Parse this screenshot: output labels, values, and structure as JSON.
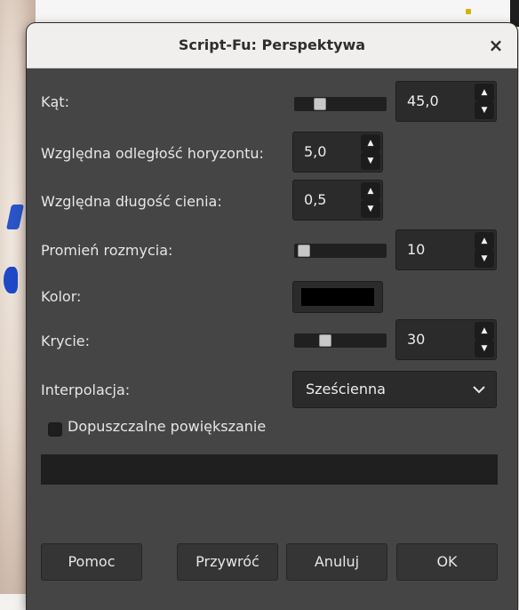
{
  "window": {
    "title": "Script-Fu: Perspektywa",
    "close_glyph": "×"
  },
  "fields": {
    "angle": {
      "label": "Kąt:",
      "value": "45,0",
      "slider_fraction": 0.21
    },
    "horizon": {
      "label": "Względna odległość horyzontu:",
      "value": "5,0"
    },
    "shadow_length": {
      "label": "Względna długość cienia:",
      "value": "0,5"
    },
    "blur_radius": {
      "label": "Promień rozmycia:",
      "value": "10",
      "slider_fraction": 0.04
    },
    "color": {
      "label": "Kolor:",
      "swatch": "#000000"
    },
    "opacity": {
      "label": "Krycie:",
      "value": "30",
      "slider_fraction": 0.3
    },
    "interpolation": {
      "label": "Interpolacja:",
      "value": "Sześcienna"
    },
    "allow_resize": {
      "label": "Dopuszczalne powiększanie",
      "checked": false
    }
  },
  "buttons": {
    "help": "Pomoc",
    "reset": "Przywróć",
    "cancel": "Anuluj",
    "ok": "OK"
  }
}
